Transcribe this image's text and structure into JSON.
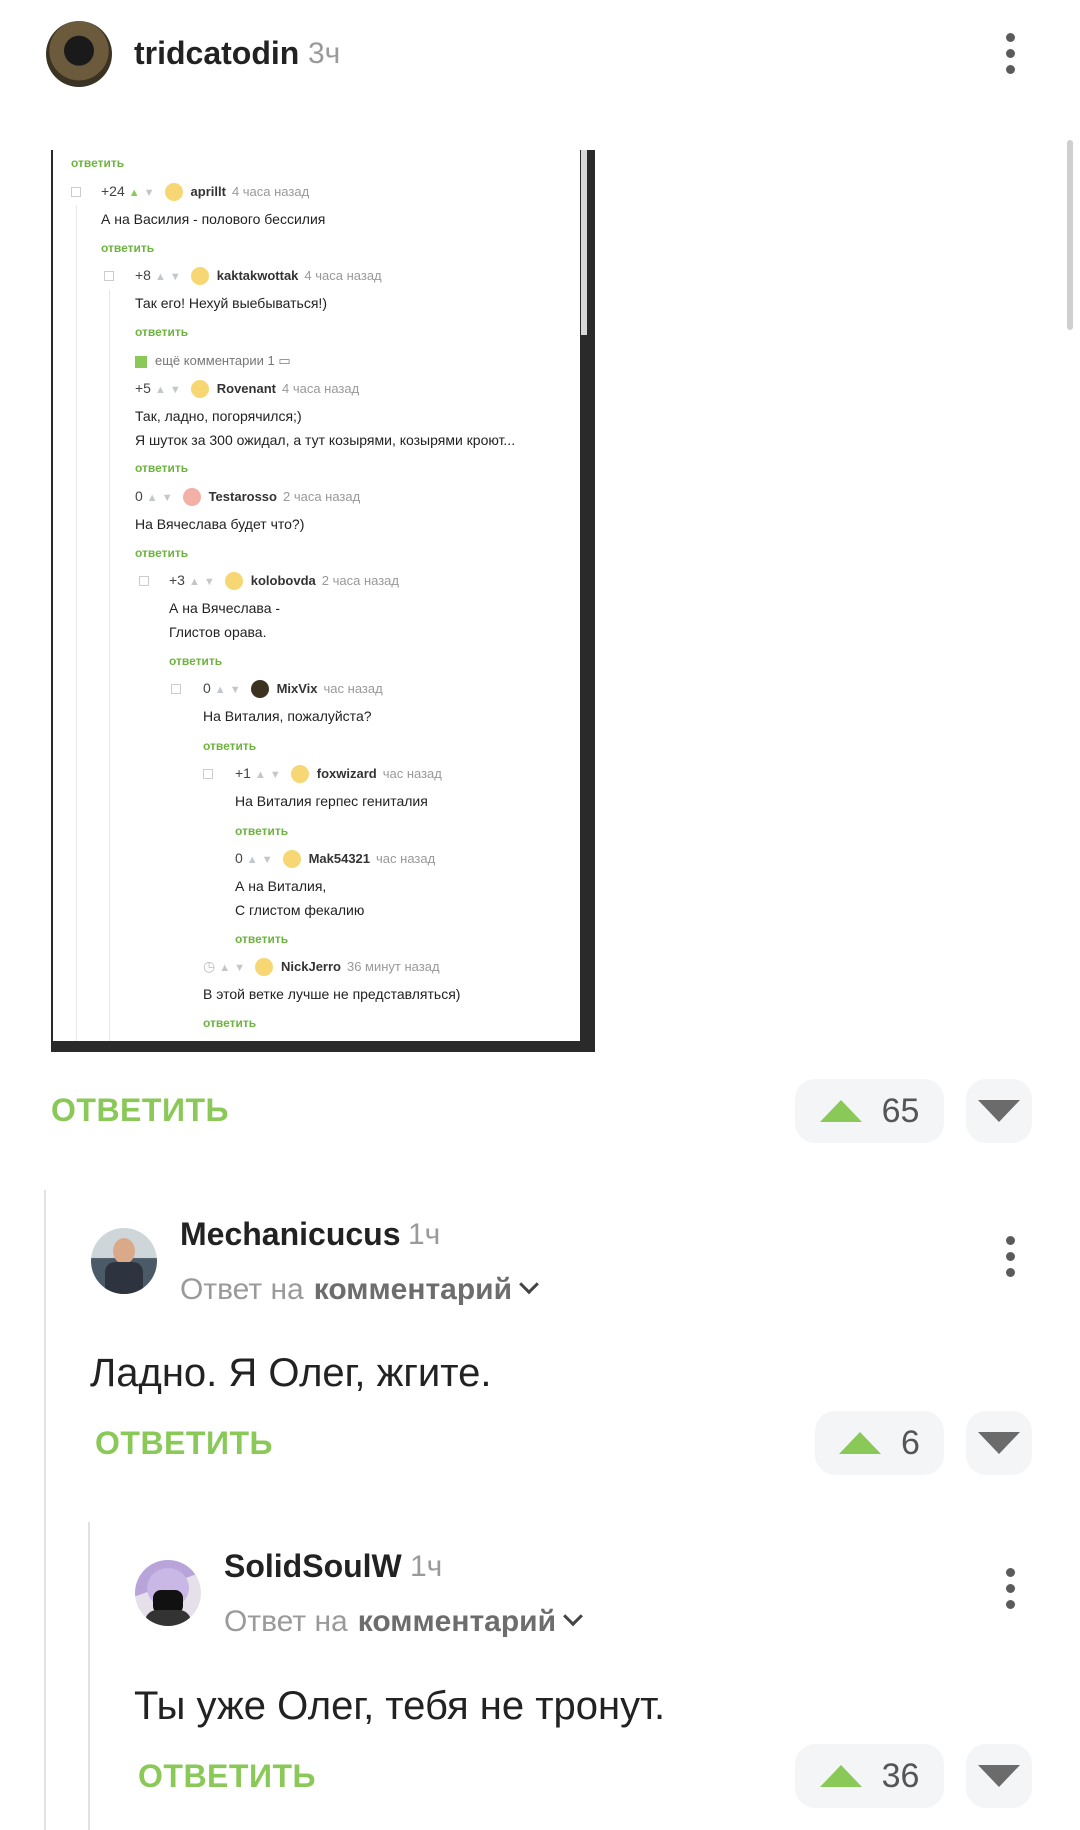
{
  "post": {
    "author": "tridcatodin",
    "time": "3ч",
    "reply_label": "ОТВЕТИТЬ",
    "votes": "65"
  },
  "embedded": {
    "top_reply": "ответить",
    "comments": [
      {
        "score": "+24",
        "nick": "aprillt",
        "when": "4 часа назад",
        "lines": [
          "А на Василия - полового бессилия"
        ],
        "reply": "ответить"
      },
      {
        "score": "+8",
        "nick": "kaktakwottak",
        "when": "4 часа назад",
        "lines": [
          "Так его! Нехуй выебываться!)"
        ],
        "reply": "ответить"
      },
      {
        "more": "ещё комментарии 1"
      },
      {
        "score": "+5",
        "nick": "Rovenant",
        "when": "4 часа назад",
        "lines": [
          "Так, ладно, погорячился;)",
          "Я шуток за 300 ожидал, а тут козырями, козырями кроют..."
        ],
        "reply": "ответить"
      },
      {
        "score": "0",
        "nick": "Testarosso",
        "when": "2 часа назад",
        "lines": [
          "На Вячеслава будет что?)"
        ],
        "reply": "ответить"
      },
      {
        "score": "+3",
        "nick": "kolobovda",
        "when": "2 часа назад",
        "lines": [
          "А на Вячеслава -",
          "Глистов орава."
        ],
        "reply": "ответить"
      },
      {
        "score": "0",
        "nick": "MixVix",
        "when": "час назад",
        "lines": [
          "На Виталия, пожалуйста?"
        ],
        "reply": "ответить"
      },
      {
        "score": "+1",
        "nick": "foxwizard",
        "when": "час назад",
        "lines": [
          "На Виталия герпес гениталия"
        ],
        "reply": "ответить"
      },
      {
        "score": "0",
        "nick": "Mak54321",
        "when": "час назад",
        "lines": [
          "А на Виталия,",
          "С глистом фекалию"
        ],
        "reply": "ответить"
      },
      {
        "score": "",
        "nick": "NickJerro",
        "when": "36 минут назад",
        "lines": [
          "В этой ветке лучше не представляться)"
        ],
        "reply": "ответить"
      }
    ]
  },
  "comments": [
    {
      "author": "Mechanicucus",
      "time": "1ч",
      "reply_to_prefix": "Ответ на",
      "reply_to_link": "комментарий",
      "text": "Ладно. Я Олег, жгите.",
      "reply_label": "ОТВЕТИТЬ",
      "votes": "6"
    },
    {
      "author": "SolidSoulW",
      "time": "1ч",
      "reply_to_prefix": "Ответ на",
      "reply_to_link": "комментарий",
      "text": "Ты уже Олег, тебя не тронут.",
      "reply_label": "ОТВЕТИТЬ",
      "votes": "36"
    }
  ],
  "icons": {
    "upvote": "triangle-up-icon",
    "downvote": "triangle-down-icon",
    "more": "kebab-icon",
    "expand": "chevron-down-icon"
  },
  "colors": {
    "accent": "#8ac858",
    "muted": "#9a9a9a"
  }
}
